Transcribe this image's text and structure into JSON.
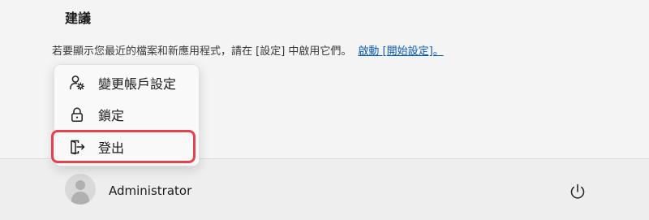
{
  "recommended": {
    "title": "建議",
    "message": "若要顯示您最近的檔案和新應用程式，請在 [設定] 中啟用它們。",
    "link_label": "啟動 [開始設定]。"
  },
  "account_menu": {
    "items": [
      {
        "label": "變更帳戶設定",
        "icon": "person-gear-icon"
      },
      {
        "label": "鎖定",
        "icon": "lock-icon"
      },
      {
        "label": "登出",
        "icon": "sign-out-icon"
      }
    ]
  },
  "user": {
    "name": "Administrator"
  },
  "colors": {
    "accent_link": "#0a5bb5",
    "highlight": "#e4424d"
  }
}
